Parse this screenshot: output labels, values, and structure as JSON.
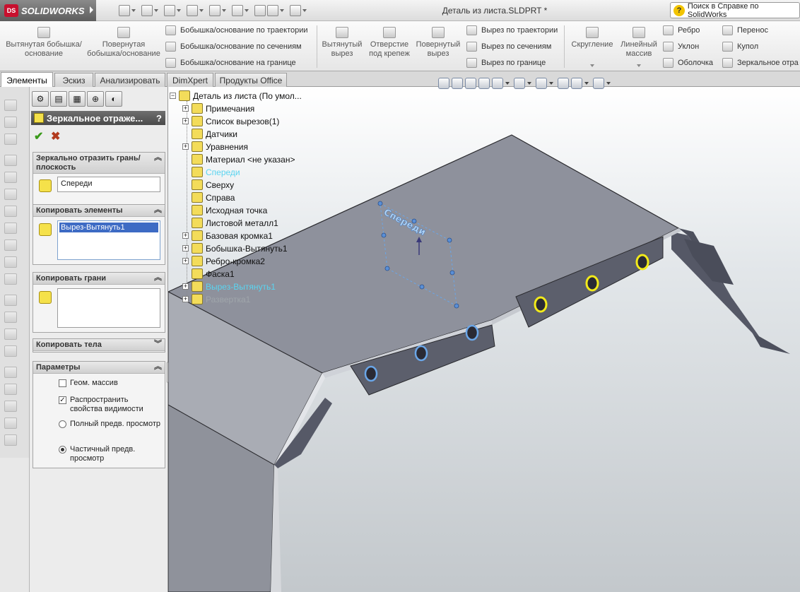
{
  "app": {
    "logo_text": "SOLIDWORKS",
    "document_title": "Деталь из листа.SLDPRT *",
    "help_search_placeholder": "Поиск в Справке по SolidWorks"
  },
  "ribbon": {
    "extruded_boss": "Вытянутая бобышка/основание",
    "revolved_boss": "Повернутая бобышка/основание",
    "swept_boss": "Бобышка/основание по траектории",
    "lofted_boss": "Бобышка/основание по сечениям",
    "boundary_boss": "Бобышка/основание на границе",
    "extruded_cut": "Вытянутый вырез",
    "hole_wizard": "Отверстие под крепеж",
    "revolved_cut": "Повернутый вырез",
    "swept_cut": "Вырез по траектории",
    "lofted_cut": "Вырез по сечениям",
    "boundary_cut": "Вырез по границе",
    "fillet": "Скругление",
    "linear_pattern": "Линейный массив",
    "rib": "Ребро",
    "draft": "Уклон",
    "shell": "Оболочка",
    "wrap": "Перенос",
    "dome": "Купол",
    "mirror": "Зеркальное отра"
  },
  "tabs": [
    "Элементы",
    "Эскиз",
    "Анализировать",
    "DimXpert",
    "Продукты Office"
  ],
  "property_manager": {
    "title": "Зеркальное отраже...",
    "help": "?",
    "ok": "✔",
    "cancel": "✖",
    "mirror_face_header": "Зеркально отразить грань/плоскость",
    "mirror_face_value": "Спереди",
    "features_header": "Копировать элементы",
    "features_item": "Вырез-Вытянуть1",
    "faces_header": "Копировать грани",
    "bodies_header": "Копировать тела",
    "options_header": "Параметры",
    "geometry_pattern": "Геом. массив",
    "propagate_visual": "Распространить свойства видимости",
    "full_preview": "Полный предв. просмотр",
    "partial_preview": "Частичный предв. просмотр",
    "options": {
      "geometry_pattern": false,
      "propagate_visual": true,
      "full_preview": false,
      "partial_preview": true
    }
  },
  "feature_tree": {
    "root": "Деталь из листа  (По умол...",
    "items": [
      {
        "label": "Примечания",
        "expandable": true,
        "state": "normal"
      },
      {
        "label": "Список вырезов(1)",
        "expandable": true,
        "state": "normal"
      },
      {
        "label": "Датчики",
        "expandable": false,
        "state": "normal"
      },
      {
        "label": "Уравнения",
        "expandable": true,
        "state": "normal"
      },
      {
        "label": "Материал <не указан>",
        "expandable": false,
        "state": "normal"
      },
      {
        "label": "Спереди",
        "expandable": false,
        "state": "highlight"
      },
      {
        "label": "Сверху",
        "expandable": false,
        "state": "normal"
      },
      {
        "label": "Справа",
        "expandable": false,
        "state": "normal"
      },
      {
        "label": "Исходная точка",
        "expandable": false,
        "state": "normal"
      },
      {
        "label": "Листовой металл1",
        "expandable": false,
        "state": "normal"
      },
      {
        "label": "Базовая кромка1",
        "expandable": true,
        "state": "normal"
      },
      {
        "label": "Бобышка-Вытянуть1",
        "expandable": true,
        "state": "normal"
      },
      {
        "label": "Ребро-кромка2",
        "expandable": true,
        "state": "normal"
      },
      {
        "label": "Фаска1",
        "expandable": false,
        "state": "normal"
      },
      {
        "label": "Вырез-Вытянуть1",
        "expandable": true,
        "state": "highlight"
      },
      {
        "label": "Развертка1",
        "expandable": true,
        "state": "dim"
      }
    ]
  },
  "viewport": {
    "plane_label": "Спереди"
  },
  "colors": {
    "highlight_text": "#5ad4f0",
    "part_top": "#8d909b",
    "part_side": "#5f6270",
    "selected_edge": "#f2ea1a",
    "preview_hole": "#6aa6e8"
  }
}
